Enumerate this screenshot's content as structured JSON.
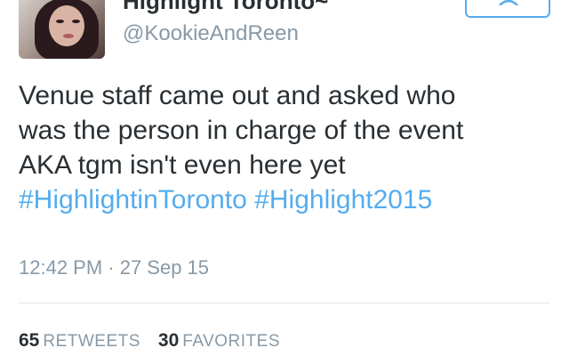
{
  "user": {
    "display_name": "Highlight Toronto~",
    "handle": "@KookieAndReen"
  },
  "follow_button": {
    "icon": "person-icon",
    "color": "#55acee"
  },
  "tweet": {
    "line1": "Venue staff came out and asked who",
    "line2": "was the person in charge of the event",
    "line3": "AKA tgm isn't even here yet",
    "hashtag1": "#HighlightinToronto",
    "hashtag2": "#Highlight2015",
    "timestamp": "12:42 PM · 27 Sep 15"
  },
  "stats": {
    "retweets_count": "65",
    "retweets_label": "RETWEETS",
    "favorites_count": "30",
    "favorites_label": "FAVORITES"
  },
  "colors": {
    "link": "#55acee",
    "muted": "#8899a6",
    "text": "#292f33"
  }
}
